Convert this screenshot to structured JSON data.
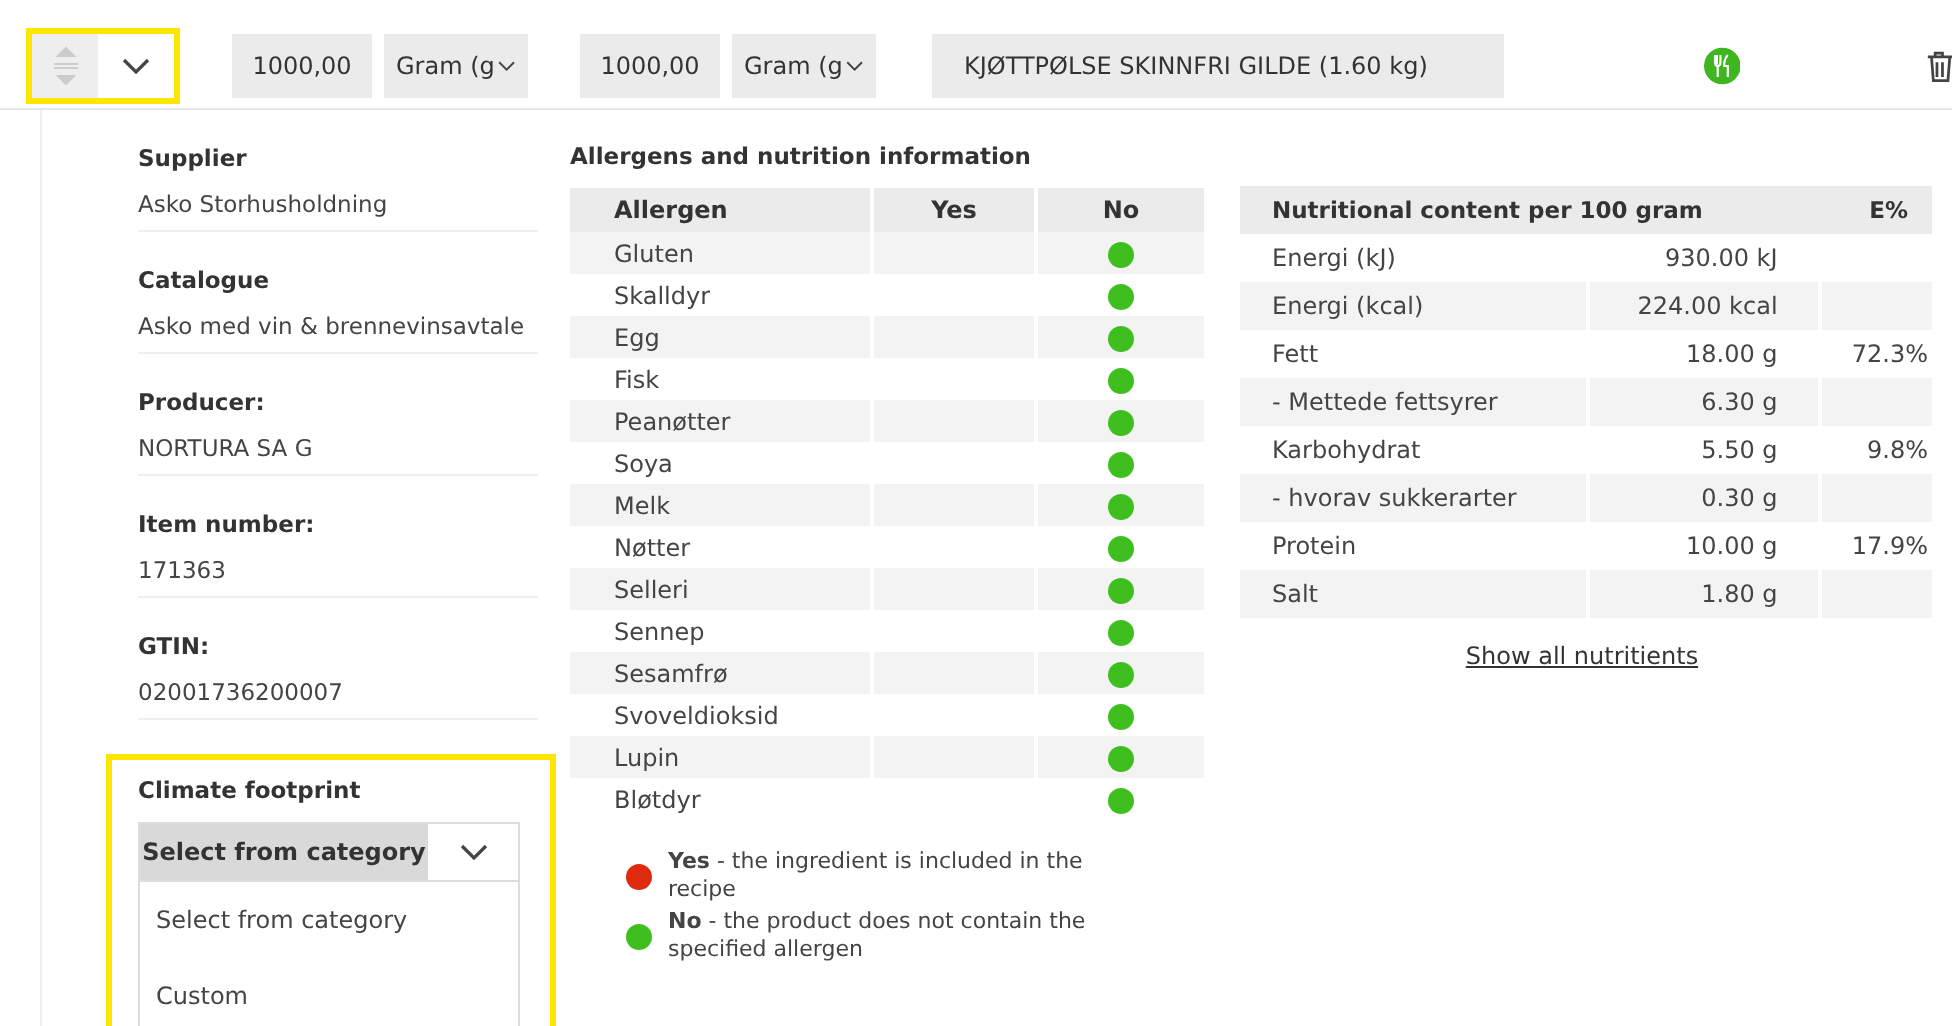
{
  "toolbar": {
    "quantity_fields": [
      {
        "value": "1000,00",
        "unit": "Gram (g"
      },
      {
        "value": "1000,00",
        "unit": "Gram (g"
      }
    ],
    "product": "KJØTTPØLSE SKINNFRI GILDE  (1.60 kg)"
  },
  "details": [
    {
      "label": "Supplier",
      "value": "Asko Storhusholdning"
    },
    {
      "label": "Catalogue",
      "value": "Asko med vin & brennevinsavtale"
    },
    {
      "label": "Producer:",
      "value": "NORTURA SA G"
    },
    {
      "label": "Item number:",
      "value": "171363"
    },
    {
      "label": "GTIN:",
      "value": "02001736200007"
    }
  ],
  "climate": {
    "label": "Climate footprint",
    "value": "Select from category",
    "expanded": true,
    "options": [
      "Select from category",
      "Custom"
    ]
  },
  "allergens": {
    "title": "Allergens and nutrition information",
    "columns": [
      "Allergen",
      "Yes",
      "No"
    ],
    "rows": [
      {
        "name": "Gluten",
        "contains": false
      },
      {
        "name": "Skalldyr",
        "contains": false
      },
      {
        "name": "Egg",
        "contains": false
      },
      {
        "name": "Fisk",
        "contains": false
      },
      {
        "name": "Peanøtter",
        "contains": false
      },
      {
        "name": "Soya",
        "contains": false
      },
      {
        "name": "Melk",
        "contains": false
      },
      {
        "name": "Nøtter",
        "contains": false
      },
      {
        "name": "Selleri",
        "contains": false
      },
      {
        "name": "Sennep",
        "contains": false
      },
      {
        "name": "Sesamfrø",
        "contains": false
      },
      {
        "name": "Svoveldioksid",
        "contains": false
      },
      {
        "name": "Lupin",
        "contains": false
      },
      {
        "name": "Bløtdyr",
        "contains": false
      }
    ],
    "legend": [
      {
        "text": "**Yes** - the ingredient is included in the recipe",
        "color": "#e02a10"
      },
      {
        "text": "**No** - the product does not contain the specified allergen",
        "color": "#3fbf1f"
      }
    ]
  },
  "nutrition": {
    "columns": [
      "Nutritional content per 100 gram",
      "E%"
    ],
    "rows": [
      {
        "name": "Energi (kJ)",
        "amount": "930.00 kJ"
      },
      {
        "name": "Energi (kcal)",
        "amount": "224.00 kcal"
      },
      {
        "name": "Fett",
        "amount": "18.00 g",
        "energy_percent": "72.3%"
      },
      {
        "name": "- Mettede fettsyrer",
        "amount": "6.30 g"
      },
      {
        "name": "Karbohydrat",
        "amount": "5.50 g",
        "energy_percent": "9.8%"
      },
      {
        "name": "- hvorav sukkerarter",
        "amount": "0.30 g"
      },
      {
        "name": "Protein",
        "amount": "10.00 g",
        "energy_percent": "17.9%"
      },
      {
        "name": "Salt",
        "amount": "1.80 g"
      }
    ],
    "link": "Show all nutritients"
  }
}
